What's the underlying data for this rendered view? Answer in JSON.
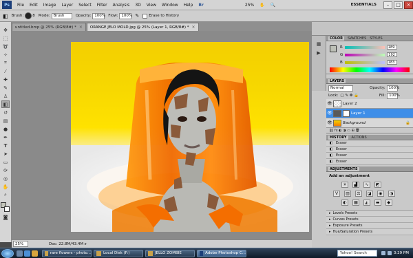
{
  "menubar": {
    "logo": "Ps",
    "items": [
      "File",
      "Edit",
      "Image",
      "Layer",
      "Select",
      "Filter",
      "Analysis",
      "3D",
      "View",
      "Window",
      "Help"
    ],
    "zoom": "25%",
    "workspace": "ESSENTIALS"
  },
  "options": {
    "brush_label": "Brush:",
    "brush_size": "8",
    "mode_label": "Mode:",
    "mode_value": "Brush",
    "opacity_label": "Opacity:",
    "opacity_value": "100%",
    "flow_label": "Flow:",
    "flow_value": "100%",
    "erase_history": "Erase to History"
  },
  "tabs": [
    {
      "label": "untitled.bmp @ 25% (RGB/8#) *"
    },
    {
      "label": "ORANGE JELO MOLD.jpg @ 25% (Layer 1, RGB/8#) *"
    }
  ],
  "status": {
    "zoom": "25%",
    "doc": "Doc: 22.8M/43.4M"
  },
  "color_panel": {
    "tabs": [
      "COLOR",
      "SWATCHES",
      "STYLES"
    ],
    "channels": [
      {
        "label": "R",
        "value": "189"
      },
      {
        "label": "G",
        "value": "192"
      },
      {
        "label": "B",
        "value": "183"
      }
    ]
  },
  "layers_panel": {
    "title": "LAYERS",
    "blend": "Normal",
    "opacity_label": "Opacity:",
    "opacity": "100%",
    "lock_label": "Lock:",
    "fill_label": "Fill:",
    "fill": "100%",
    "layers": [
      {
        "name": "Layer 2"
      },
      {
        "name": "Layer 1"
      },
      {
        "name": "Background"
      }
    ]
  },
  "history_panel": {
    "tabs": [
      "HISTORY",
      "ACTIONS"
    ],
    "items": [
      "Eraser",
      "Eraser",
      "Eraser",
      "Eraser"
    ]
  },
  "adjustments_panel": {
    "title": "ADJUSTMENTS",
    "subtitle": "Add an adjustment",
    "presets": [
      "Levels Presets",
      "Curves Presets",
      "Exposure Presets",
      "Hue/Saturation Presets"
    ]
  },
  "taskbar": {
    "tasks": [
      {
        "label": "rare flowers - photo..."
      },
      {
        "label": "Local Disk (F:)"
      },
      {
        "label": "JELLO ZOMBIE"
      },
      {
        "label": "Adobe Photoshop C..."
      }
    ],
    "search": "Yahoo! Search",
    "clock": "3:29 PM"
  },
  "colors": {
    "accent": "#3e8ee8",
    "jello_orange": "#f07a00",
    "background_yellow": "#f5d400"
  }
}
